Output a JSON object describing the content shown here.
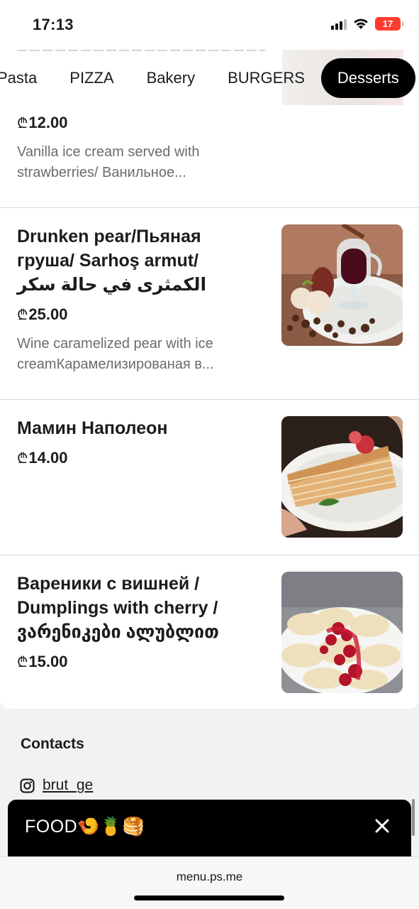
{
  "status_bar": {
    "time": "17:13",
    "battery": "17"
  },
  "categories": {
    "tabs": [
      "Pasta",
      "PIZZA",
      "Bakery",
      "BURGERS",
      "Desserts"
    ],
    "active": "Desserts"
  },
  "currency_symbol": "₾",
  "items": [
    {
      "price": "12.00",
      "description": "Vanilla ice cream served with strawberries/ Ванильное..."
    },
    {
      "title": "Drunken pear/Пьяная груша/ Sarhoş armut/ الكمثرى في حالة سكر",
      "price": "25.00",
      "description": "Wine caramelized pear with ice creamКарамелизированая в...",
      "photo": "drunken-pear-photo"
    },
    {
      "title": "Мамин Наполеон",
      "price": "14.00",
      "photo": "napoleon-cake-photo"
    },
    {
      "title": "Вареники с вишней / Dumplings with cherry / ვარენიკები ალუბლით",
      "price": "15.00",
      "photo": "cherry-dumplings-photo"
    }
  ],
  "contacts": {
    "heading": "Contacts",
    "instagram": "brut_ge"
  },
  "banner": {
    "title": "FOOD🍤🍍🥞"
  },
  "browser": {
    "url": "menu.ps.me"
  },
  "colors": {
    "accent": "#000000",
    "muted_text": "#6c6c70",
    "background": "#f2f2f5",
    "battery_low": "#ff3b30"
  }
}
